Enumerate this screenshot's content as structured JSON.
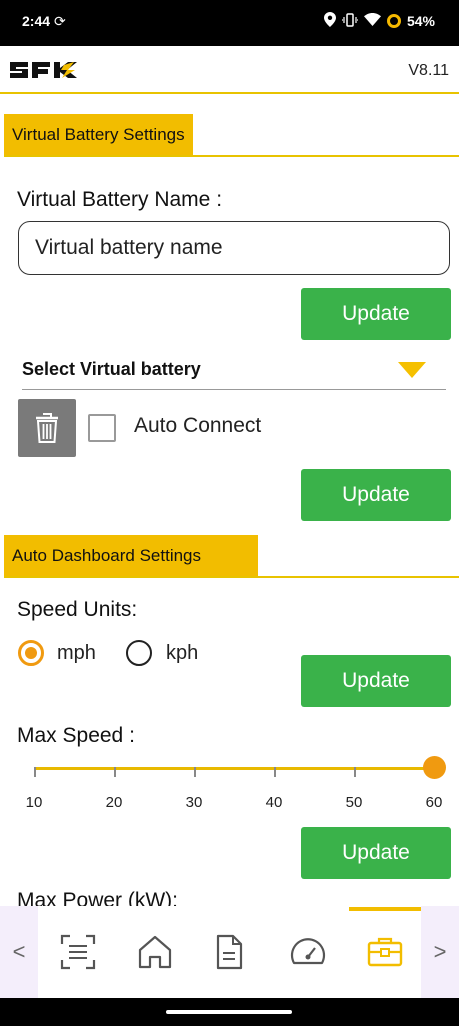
{
  "status": {
    "time": "2:44",
    "battery_percent": "54%"
  },
  "header": {
    "version": "V8.11"
  },
  "virtual_battery": {
    "section_title": "Virtual Battery Settings",
    "name_label": "Virtual Battery Name :",
    "name_value": "Virtual battery name",
    "update_label": "Update",
    "select_label": "Select Virtual battery",
    "auto_connect_label": "Auto Connect",
    "auto_connect_checked": false,
    "update2_label": "Update"
  },
  "auto_dashboard": {
    "section_title": "Auto Dashboard Settings",
    "speed_units_label": "Speed Units:",
    "units": [
      {
        "label": "mph",
        "selected": true
      },
      {
        "label": "kph",
        "selected": false
      }
    ],
    "update_label": "Update",
    "max_speed_label": "Max Speed :",
    "max_speed_value": 60,
    "slider_ticks": [
      "10",
      "20",
      "30",
      "40",
      "50",
      "60"
    ],
    "update2_label": "Update",
    "max_power_label": "Max Power (kW):"
  },
  "nav": {
    "items": [
      "scan-icon",
      "home-icon",
      "document-icon",
      "speedometer-icon",
      "toolbox-icon"
    ],
    "active": "toolbox-icon",
    "prev_arrow": "<",
    "next_arrow": ">"
  },
  "colors": {
    "accent": "#f2bd00",
    "button": "#3ab24a",
    "radio": "#f09a10"
  }
}
